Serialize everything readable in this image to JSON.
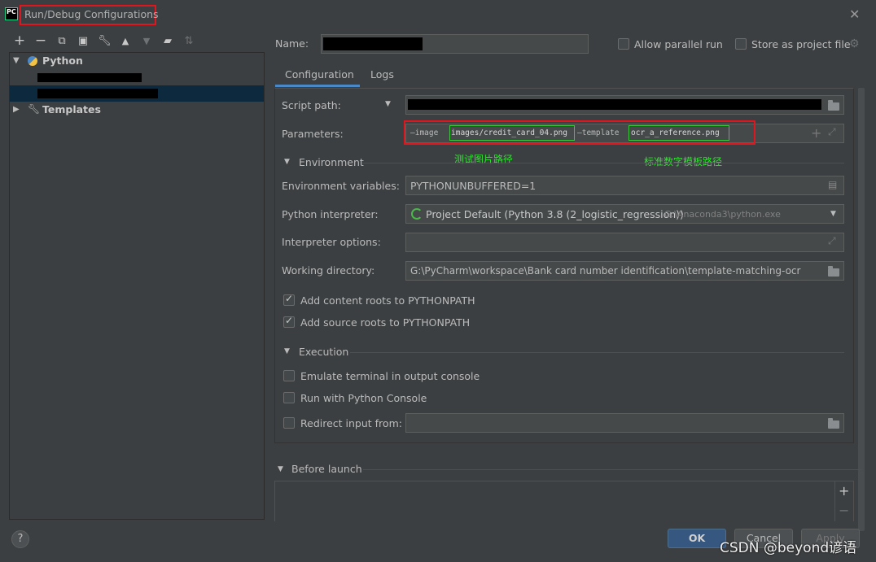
{
  "window": {
    "title": "Run/Debug Configurations"
  },
  "toolbar": {
    "icons": [
      "add-icon",
      "remove-icon",
      "copy-icon",
      "save-icon",
      "wrench-icon",
      "move-up-icon",
      "move-down-icon",
      "new-folder-icon",
      "sort-icon"
    ]
  },
  "tree": {
    "python_label": "Python",
    "templates_label": "Templates"
  },
  "header": {
    "name_label": "Name:",
    "allow_parallel_label": "Allow parallel run",
    "store_project_label": "Store as project file"
  },
  "tabs": [
    {
      "label": "Configuration"
    },
    {
      "label": "Logs"
    }
  ],
  "form": {
    "script_path_label": "Script path:",
    "parameters_label": "Parameters:",
    "params": {
      "image_flag": "—image",
      "image_value": "images/credit_card_04.png",
      "template_flag": "—template",
      "template_value": "ocr_a_reference.png"
    },
    "annotations": {
      "image_note": "测试图片路径",
      "template_note": "标准数字模板路径"
    },
    "environment_section": "Environment",
    "env_vars_label": "Environment variables:",
    "env_vars_value": "PYTHONUNBUFFERED=1",
    "interpreter_label": "Python interpreter:",
    "interpreter_value": "Project Default (Python 3.8 (2_logistic_regression))",
    "interpreter_path": "G:\\Anaconda3\\python.exe",
    "interp_options_label": "Interpreter options:",
    "working_dir_label": "Working directory:",
    "working_dir_value": "G:\\PyCharm\\workspace\\Bank card number identification\\template-matching-ocr",
    "content_roots_label": "Add content roots to PYTHONPATH",
    "source_roots_label": "Add source roots to PYTHONPATH",
    "execution_section": "Execution",
    "emulate_terminal_label": "Emulate terminal in output console",
    "python_console_label": "Run with Python Console",
    "redirect_input_label": "Redirect input from:"
  },
  "before_launch": {
    "section": "Before launch"
  },
  "footer": {
    "ok_label": "OK",
    "cancel_label": "Cancel",
    "apply_label": "Apply",
    "watermark": "CSDN @beyond谚语"
  },
  "colors": {
    "background": "#3c3f41",
    "highlight_red": "#e0161e",
    "highlight_green": "#3ac93a",
    "annotation_green": "#2fe32f",
    "accent_blue": "#4a88c7",
    "ok_button": "#365880"
  }
}
